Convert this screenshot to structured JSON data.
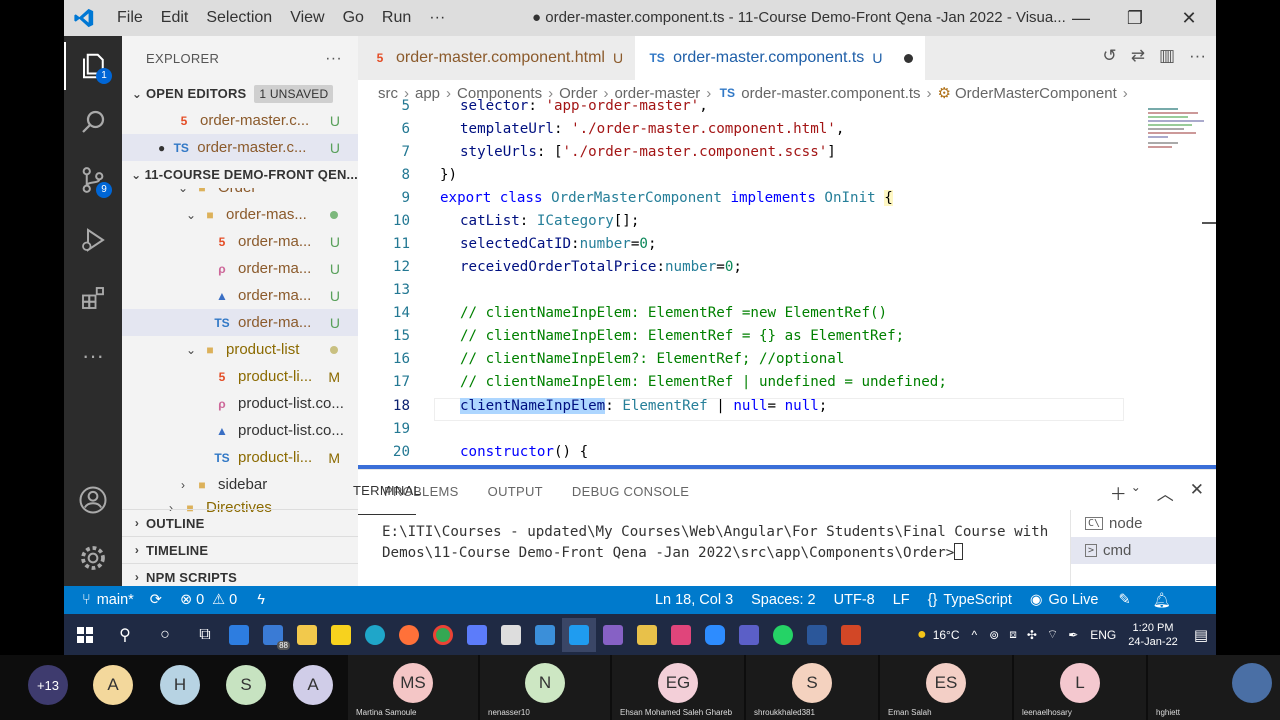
{
  "window": {
    "menu": [
      "File",
      "Edit",
      "Selection",
      "View",
      "Go",
      "Run",
      "···"
    ],
    "title": "● order-master.component.ts - 11-Course Demo-Front Qena -Jan 2022 - Visua...",
    "controls": [
      "—",
      "❐",
      "✕"
    ]
  },
  "activity": {
    "explorer_badge": "1",
    "scm_badge": "9"
  },
  "sidebar": {
    "title": "EXPLORER",
    "more": "···",
    "open_editors": "OPEN EDITORS",
    "unsaved": "1 UNSAVED",
    "open_files": [
      {
        "icon": "5",
        "name": "order-master.c...",
        "status": "U"
      },
      {
        "icon": "TS",
        "name": "order-master.c...",
        "status": "U"
      }
    ],
    "project": "11-COURSE DEMO-FRONT QEN...",
    "tree": [
      {
        "name": "Order"
      },
      {
        "name": "order-mas..."
      },
      {
        "icon": "5",
        "name": "order-ma...",
        "status": "U"
      },
      {
        "icon": "ρ",
        "name": "order-ma...",
        "status": "U"
      },
      {
        "icon": "▲",
        "name": "order-ma...",
        "status": "U"
      },
      {
        "icon": "TS",
        "name": "order-ma...",
        "status": "U"
      },
      {
        "name": "product-list"
      },
      {
        "icon": "5",
        "name": "product-li...",
        "status": "M"
      },
      {
        "icon": "ρ",
        "name": "product-list.co..."
      },
      {
        "icon": "▲",
        "name": "product-list.co..."
      },
      {
        "icon": "TS",
        "name": "product-li...",
        "status": "M"
      },
      {
        "name": "sidebar"
      },
      {
        "name": "Directives"
      }
    ],
    "sections": [
      "OUTLINE",
      "TIMELINE",
      "NPM SCRIPTS"
    ]
  },
  "editor": {
    "tabs": [
      {
        "icon": "5",
        "label": "order-master.component.html",
        "status": "U"
      },
      {
        "icon": "TS",
        "label": "order-master.component.ts",
        "status": "U"
      }
    ],
    "breadcrumbs": [
      "src",
      "app",
      "Components",
      "Order",
      "order-master",
      "order-master.component.ts",
      "OrderMasterComponent"
    ],
    "breadcrumb_ts_icon": "TS",
    "lines": [
      "5",
      "6",
      "7",
      "8",
      "9",
      "10",
      "11",
      "12",
      "13",
      "14",
      "15",
      "16",
      "17",
      "18",
      "19",
      "20"
    ]
  },
  "panel": {
    "tabs": [
      "TERMINAL",
      "PROBLEMS",
      "OUTPUT",
      "DEBUG CONSOLE"
    ],
    "terminal_text": "E:\\ITI\\Courses - updated\\My Courses\\Web\\Angular\\For Students\\Final Course with Demos\\11-Course Demo-Front Qena -Jan 2022\\src\\app\\Components\\Order>",
    "terminals": [
      "node",
      "cmd"
    ]
  },
  "status": {
    "branch": "main*",
    "errors": "0",
    "warnings": "0",
    "position": "Ln 18, Col 3",
    "spaces": "Spaces: 2",
    "encoding": "UTF-8",
    "eol": "LF",
    "language": "TypeScript",
    "golive": "Go Live"
  },
  "taskbar": {
    "weather": "16°C",
    "lang": "ENG",
    "time": "1:20 PM",
    "date": "24-Jan-22",
    "mail_badge": "88"
  },
  "meeting": {
    "more": "+13",
    "avatars": [
      "A",
      "H",
      "S",
      "A"
    ],
    "tiles": [
      {
        "init": "MS",
        "name": "Martina Samoule"
      },
      {
        "init": "N",
        "name": "nenasser10"
      },
      {
        "init": "EG",
        "name": "Ehsan Mohamed Saleh Ghareb"
      },
      {
        "init": "S",
        "name": "shroukkhaled381"
      },
      {
        "init": "ES",
        "name": "Eman Salah"
      },
      {
        "init": "L",
        "name": "leenaelhosary"
      },
      {
        "init": "",
        "name": "hghiett"
      }
    ]
  }
}
